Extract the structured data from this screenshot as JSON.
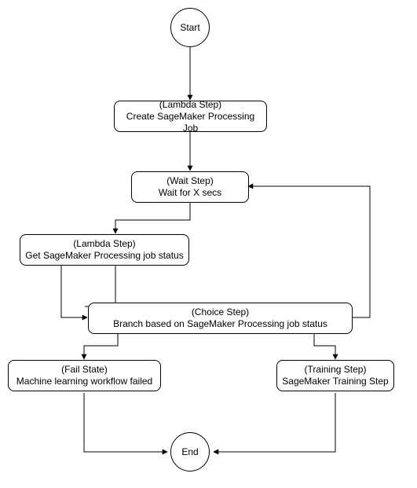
{
  "nodes": {
    "start": {
      "label": "Start"
    },
    "createJob": {
      "type": "(Lambda Step)",
      "label": "Create SageMaker Processing Job"
    },
    "wait": {
      "type": "(Wait Step)",
      "label": "Wait for X secs"
    },
    "getStatus": {
      "type": "(Lambda Step)",
      "label": "Get SageMaker Processing job status"
    },
    "choice": {
      "type": "(Choice Step)",
      "label": "Branch based on SageMaker Processing job status"
    },
    "fail": {
      "type": "(Fail State)",
      "label": "Machine learning workflow failed"
    },
    "train": {
      "type": "(Training Step)",
      "label": "SageMaker Training Step"
    },
    "end": {
      "label": "End"
    }
  }
}
